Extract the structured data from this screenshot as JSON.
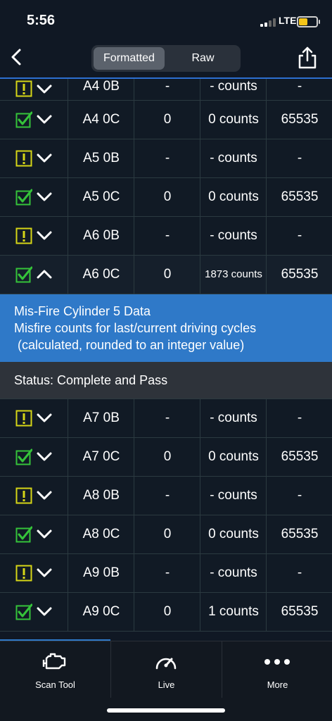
{
  "status_bar": {
    "time": "5:56",
    "network": "LTE"
  },
  "nav": {
    "segment_formatted": "Formatted",
    "segment_raw": "Raw"
  },
  "rows_top": [
    {
      "status": "warning",
      "chevron": "down",
      "id": "A4 0B",
      "value": "-",
      "counts": "- counts",
      "max": "-"
    },
    {
      "status": "pass",
      "chevron": "down",
      "id": "A4 0C",
      "value": "0",
      "counts": "0 counts",
      "max": "65535"
    },
    {
      "status": "warning",
      "chevron": "down",
      "id": "A5 0B",
      "value": "-",
      "counts": "- counts",
      "max": "-"
    },
    {
      "status": "pass",
      "chevron": "down",
      "id": "A5 0C",
      "value": "0",
      "counts": "0 counts",
      "max": "65535"
    },
    {
      "status": "warning",
      "chevron": "down",
      "id": "A6 0B",
      "value": "-",
      "counts": "- counts",
      "max": "-"
    },
    {
      "status": "pass",
      "chevron": "up",
      "id": "A6 0C",
      "value": "0",
      "counts": "1873 counts",
      "max": "65535"
    }
  ],
  "detail": {
    "title": "Mis-Fire Cylinder 5 Data",
    "line1": "Misfire counts for last/current driving cycles",
    "line2": " (calculated, rounded to an integer value)",
    "status": "Status: Complete and Pass"
  },
  "rows_bottom": [
    {
      "status": "warning",
      "chevron": "down",
      "id": "A7 0B",
      "value": "-",
      "counts": "- counts",
      "max": "-"
    },
    {
      "status": "pass",
      "chevron": "down",
      "id": "A7 0C",
      "value": "0",
      "counts": "0 counts",
      "max": "65535"
    },
    {
      "status": "warning",
      "chevron": "down",
      "id": "A8 0B",
      "value": "-",
      "counts": "- counts",
      "max": "-"
    },
    {
      "status": "pass",
      "chevron": "down",
      "id": "A8 0C",
      "value": "0",
      "counts": "0 counts",
      "max": "65535"
    },
    {
      "status": "warning",
      "chevron": "down",
      "id": "A9 0B",
      "value": "-",
      "counts": "- counts",
      "max": "-"
    },
    {
      "status": "pass",
      "chevron": "down",
      "id": "A9 0C",
      "value": "0",
      "counts": "1 counts",
      "max": "65535"
    }
  ],
  "tabs": [
    {
      "label": "Scan Tool",
      "icon": "engine-icon"
    },
    {
      "label": "Live",
      "icon": "gauge-icon"
    },
    {
      "label": "More",
      "icon": "more-dots-icon"
    }
  ],
  "colors": {
    "accent": "#2f79c8",
    "pass": "#35c33a",
    "warning": "#d6d617",
    "background": "#101824"
  }
}
